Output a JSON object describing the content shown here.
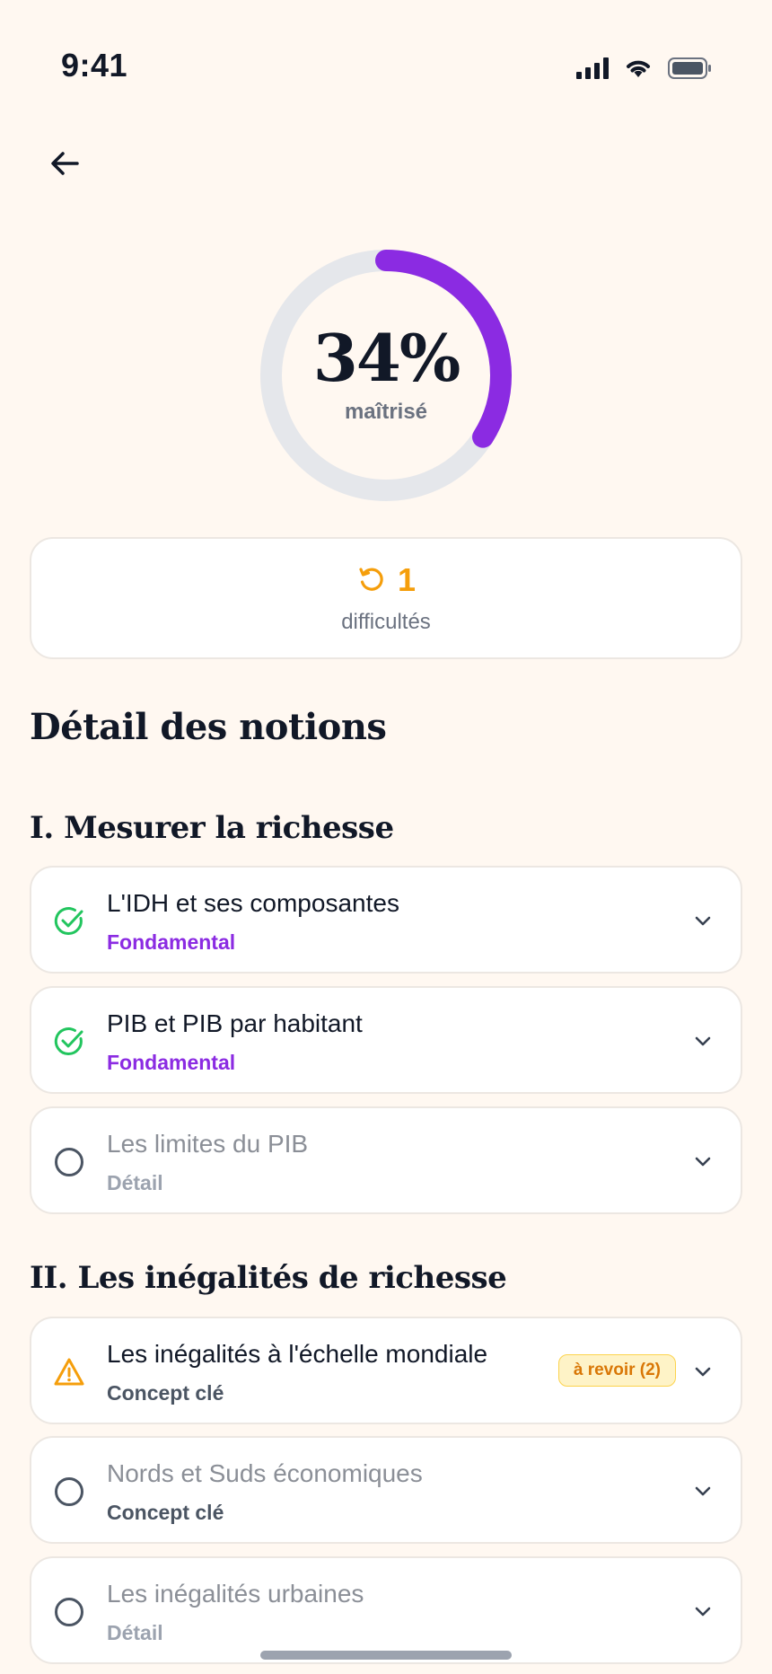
{
  "status": {
    "time": "9:41"
  },
  "progress": {
    "percent_text": "34%",
    "label": "maîtrisé",
    "value": 0.34,
    "color": "#8b2be2",
    "track_color": "#e5e7eb"
  },
  "difficulties": {
    "count": "1",
    "label": "difficultés",
    "icon": "retry-icon",
    "color": "#f59e0b"
  },
  "heading": "Détail des notions",
  "sections": [
    {
      "title": "I. Mesurer la richesse",
      "items": [
        {
          "title": "L'IDH et ses composantes",
          "tag": "Fondamental",
          "status": "done",
          "icon": "check-circle-icon"
        },
        {
          "title": "PIB et PIB par habitant",
          "tag": "Fondamental",
          "status": "done",
          "icon": "check-circle-icon"
        },
        {
          "title": "Les limites du PIB",
          "tag": "Détail",
          "status": "todo",
          "icon": "empty-circle-icon"
        }
      ]
    },
    {
      "title": "II. Les inégalités de richesse",
      "items": [
        {
          "title": "Les inégalités à l'échelle mondiale",
          "tag": "Concept clé",
          "status": "review",
          "icon": "warning-icon",
          "badge": "à revoir (2)"
        },
        {
          "title": "Nords et Suds économiques",
          "tag": "Concept clé",
          "status": "todo",
          "icon": "empty-circle-icon"
        },
        {
          "title": "Les inégalités urbaines",
          "tag": "Détail",
          "status": "todo",
          "icon": "empty-circle-icon"
        }
      ]
    }
  ],
  "colors": {
    "accent": "#8b2be2",
    "success": "#22c55e",
    "warning": "#f59e0b",
    "background": "#fff8f1"
  }
}
